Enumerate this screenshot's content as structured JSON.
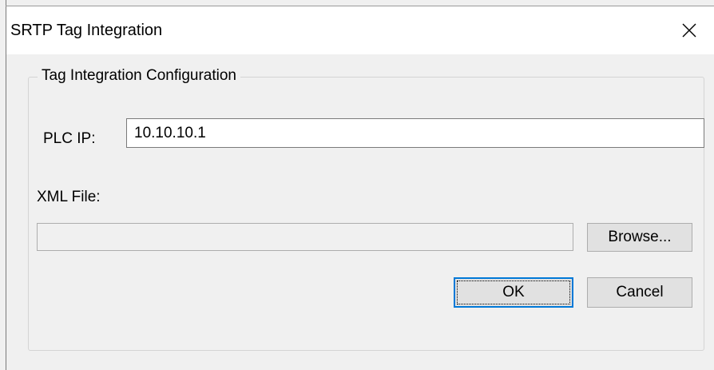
{
  "window": {
    "title": "SRTP Tag Integration",
    "close_icon": "close-icon"
  },
  "group": {
    "legend": "Tag Integration Configuration"
  },
  "plc_ip": {
    "label": "PLC IP:",
    "value": "10.10.10.1"
  },
  "xml_file": {
    "label": "XML File:",
    "value": ""
  },
  "buttons": {
    "browse": "Browse...",
    "ok": "OK",
    "cancel": "Cancel"
  },
  "colors": {
    "focus_accent": "#0078d7",
    "button_face": "#e1e1e1",
    "dialog_background": "#f0f0f0"
  }
}
